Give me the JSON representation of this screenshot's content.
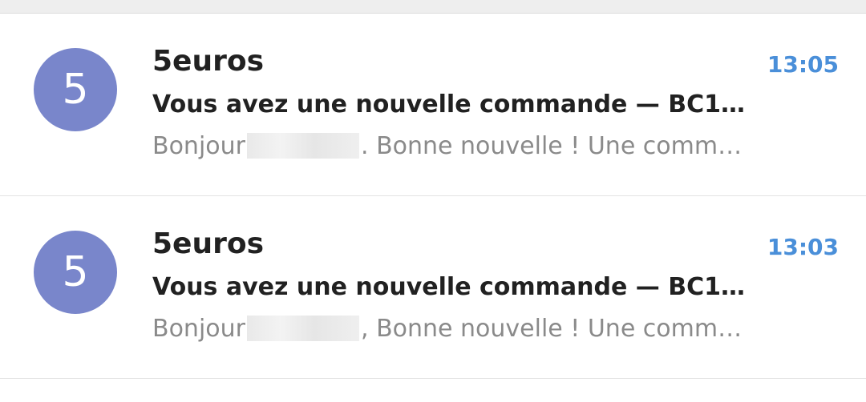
{
  "accent_color": "#4a8fd9",
  "avatar_color": "#7986cb",
  "messages": [
    {
      "avatar_letter": "5",
      "sender": "5euros",
      "time": "13:05",
      "subject": "Vous avez une nouvelle commande — BC1…",
      "preview_before": "Bonjour",
      "preview_after": ". Bonne nouvelle ! Une comm…"
    },
    {
      "avatar_letter": "5",
      "sender": "5euros",
      "time": "13:03",
      "subject": "Vous avez une nouvelle commande — BC1…",
      "preview_before": "Bonjour",
      "preview_after": ", Bonne nouvelle ! Une comm…"
    }
  ]
}
